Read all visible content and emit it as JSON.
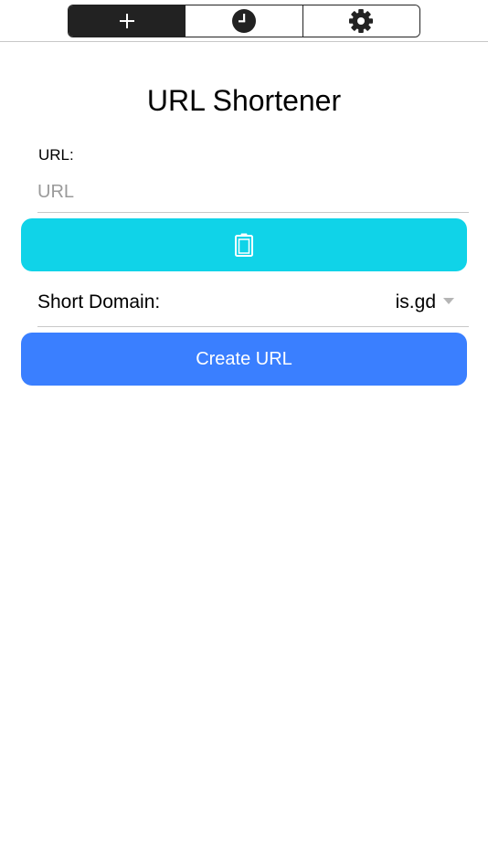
{
  "tabs": [
    {
      "icon": "plus-icon",
      "active": true
    },
    {
      "icon": "clock-icon",
      "active": false
    },
    {
      "icon": "gear-icon",
      "active": false
    }
  ],
  "main": {
    "title": "URL Shortener",
    "url_label": "URL:",
    "url_value": "",
    "url_placeholder": "URL",
    "paste_button_icon": "clipboard-icon",
    "domain_label": "Short Domain:",
    "domain_selected": "is.gd",
    "create_button_label": "Create URL"
  },
  "colors": {
    "active_tab_bg": "#222222",
    "paste_button": "#10d3e8",
    "create_button": "#3a7fff"
  }
}
